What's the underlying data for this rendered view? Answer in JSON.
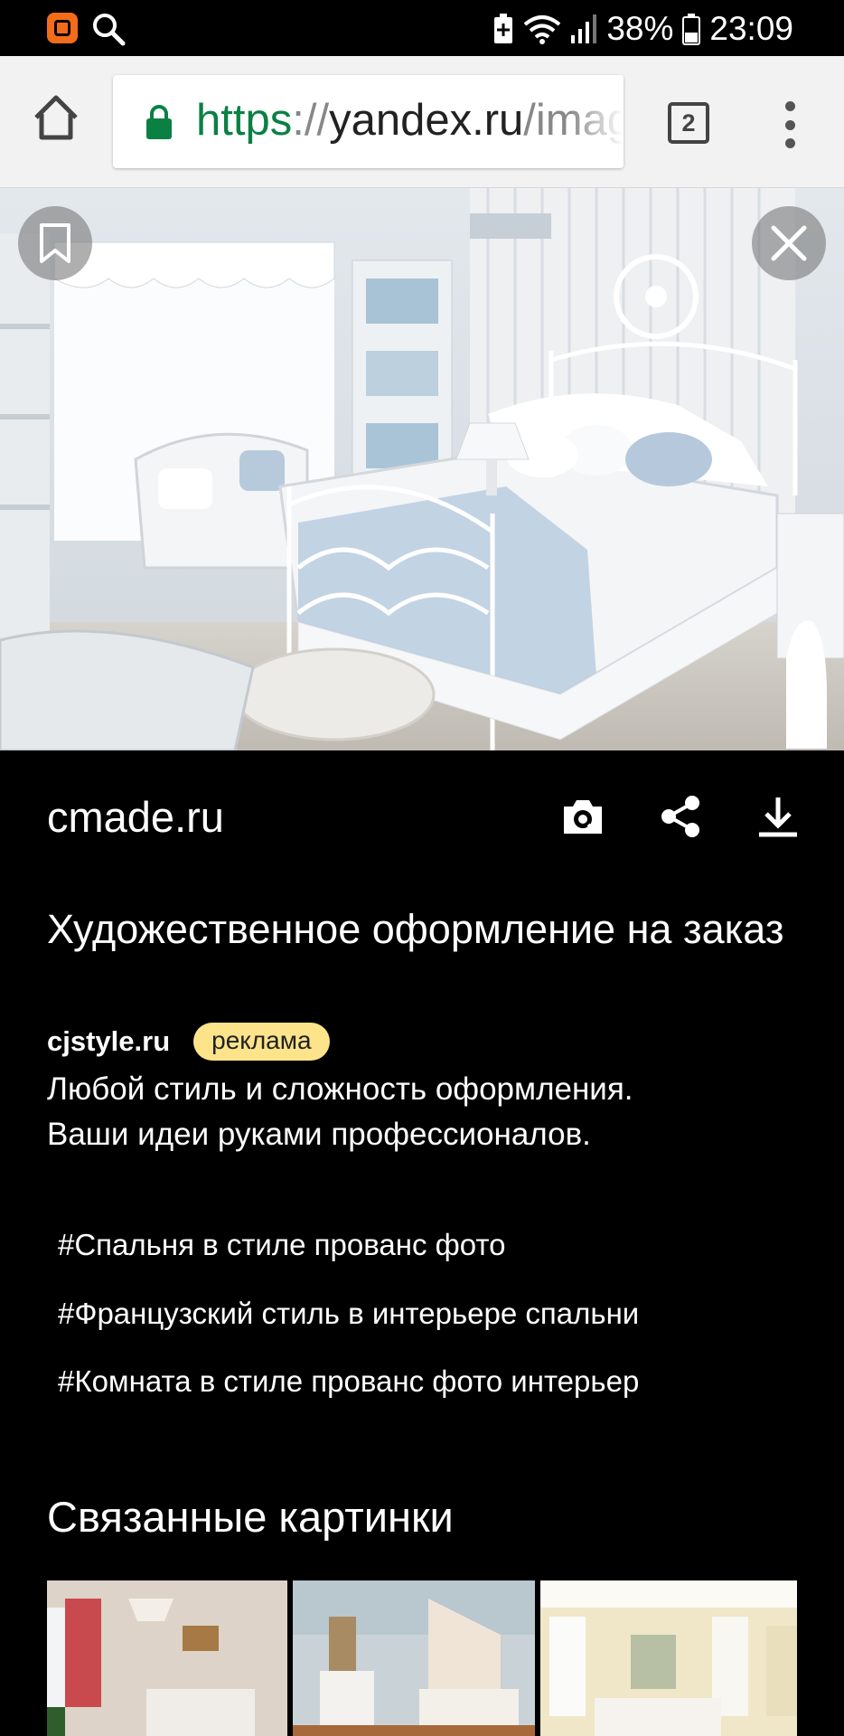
{
  "status_bar": {
    "battery_percent": "38%",
    "time": "23:09",
    "icons": [
      "mi-app-icon",
      "search-icon",
      "battery-saver-icon",
      "wifi-icon",
      "signal-icon",
      "battery-icon"
    ]
  },
  "browser": {
    "url_scheme": "https",
    "url_separator": "://",
    "url_host": "yandex.ru",
    "url_path": "/images/",
    "tab_count": "2"
  },
  "image_viewer": {
    "source_domain": "cmade.ru",
    "ad": {
      "title": "Художественное оформление на заказ",
      "domain": "cjstyle.ru",
      "badge": "реклама",
      "description_line1": "Любой стиль и сложность оформления.",
      "description_line2": "Ваши идеи руками профессионалов."
    },
    "tags": [
      "#Спальня в стиле прованс фото",
      "#Французский стиль в интерьере спальни",
      "#Комната в стиле прованс фото интерьер"
    ],
    "related_title": "Связанные картинки"
  },
  "colors": {
    "accent_orange": "#f26c1a",
    "secure_green": "#0b8043",
    "ad_badge": "#fde48b",
    "background": "#000000"
  }
}
